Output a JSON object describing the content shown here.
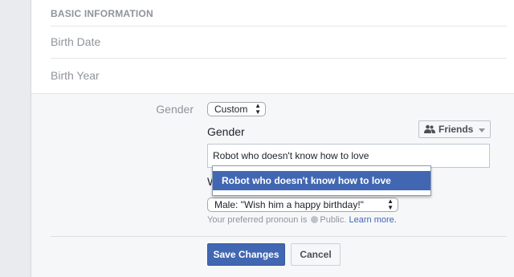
{
  "section": {
    "heading": "BASIC INFORMATION"
  },
  "rows": {
    "birth_date": "Birth Date",
    "birth_year": "Birth Year"
  },
  "gender_edit": {
    "row_label": "Gender",
    "custom_select_value": "Custom",
    "subheading": "Gender",
    "audience_label": "Friends",
    "audience_icon": "friends-icon",
    "custom_input_value": "Robot who doesn't know how to love",
    "pronoun_prefix": "W",
    "pronoun_select_value": "Male: \"Wish him a happy birthday!\"",
    "pronoun_note_text": "Your preferred pronoun is",
    "pronoun_note_visibility": "Public.",
    "learn_more": "Learn more."
  },
  "buttons": {
    "save": "Save Changes",
    "cancel": "Cancel"
  },
  "suggestion": {
    "item": "Robot who doesn't know how to love"
  },
  "colors": {
    "accent": "#4267b2",
    "background": "#e9ebee",
    "panel": "#ffffff",
    "edit_area": "#f6f7f9"
  }
}
